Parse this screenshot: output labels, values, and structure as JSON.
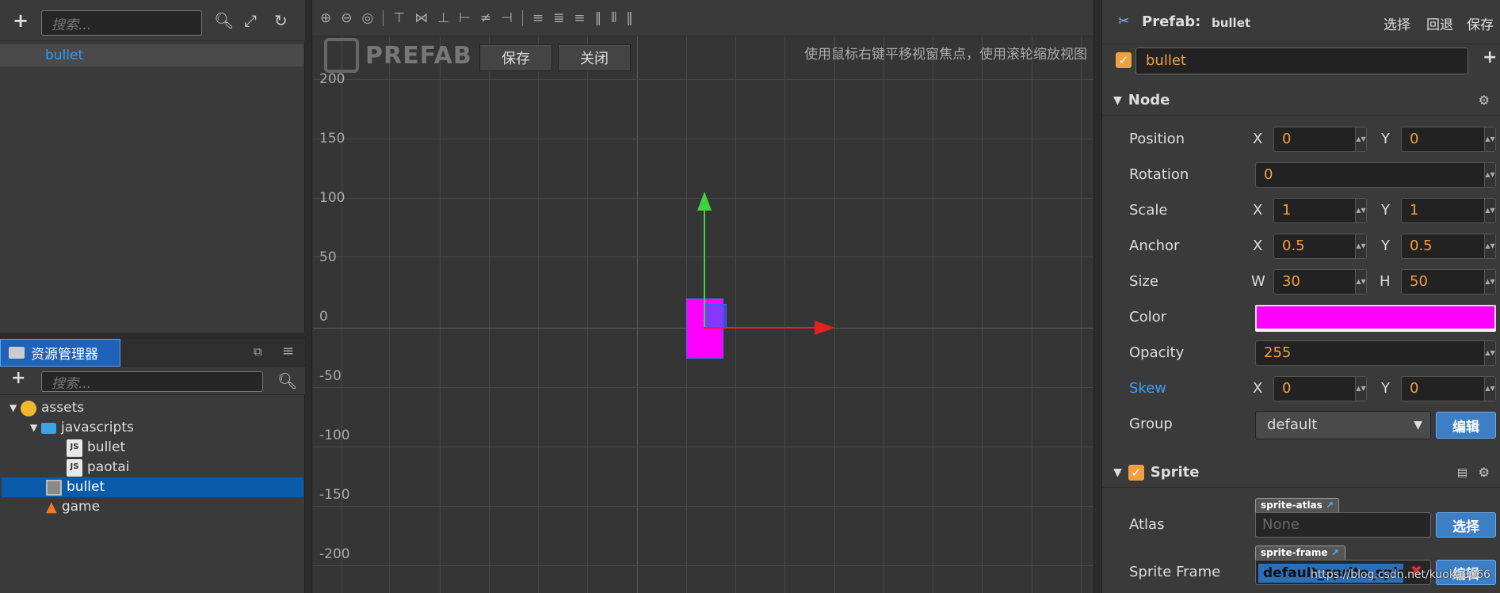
{
  "hierarchy": {
    "search_placeholder": "搜索...",
    "selected_node": "bullet"
  },
  "assets_panel": {
    "tab_label": "资源管理器",
    "search_placeholder": "搜索...",
    "tree": [
      {
        "label": "assets"
      },
      {
        "label": "javascripts"
      },
      {
        "label": "bullet"
      },
      {
        "label": "paotai"
      },
      {
        "label": "bullet"
      },
      {
        "label": "game"
      }
    ]
  },
  "scene": {
    "logo_text": "PREFAB",
    "save_label": "保存",
    "close_label": "关闭",
    "hint": "使用鼠标右键平移视窗焦点，使用滚轮缩放视图",
    "y_labels": [
      "200",
      "150",
      "100",
      "50",
      "0",
      "-50",
      "-100",
      "-150",
      "-200"
    ]
  },
  "inspector": {
    "title": "Prefab:",
    "prefab_name": "bullet",
    "actions": [
      "选择",
      "回退",
      "保存"
    ],
    "node_name": "bullet",
    "node_section": "Node",
    "position_label": "Position",
    "position_x": "0",
    "position_y": "0",
    "rotation_label": "Rotation",
    "rotation": "0",
    "scale_label": "Scale",
    "scale_x": "1",
    "scale_y": "1",
    "anchor_label": "Anchor",
    "anchor_x": "0.5",
    "anchor_y": "0.5",
    "size_label": "Size",
    "size_w": "30",
    "size_h": "50",
    "color_label": "Color",
    "color_value": "#ff00ff",
    "opacity_label": "Opacity",
    "opacity": "255",
    "skew_label": "Skew",
    "skew_x": "0",
    "skew_y": "0",
    "group_label": "Group",
    "group_value": "default",
    "edit_label": "编辑",
    "sprite_section": "Sprite",
    "atlas_label": "Atlas",
    "atlas_tag": "sprite-atlas",
    "atlas_value": "None",
    "select_label": "选择",
    "sprite_frame_label": "Sprite Frame",
    "sprite_frame_tag": "sprite-frame",
    "sprite_frame_value": "default_sprite_spla",
    "axis_x": "X",
    "axis_y": "Y",
    "axis_w": "W",
    "axis_h": "H"
  },
  "watermark": "https://blog.csdn.net/kuoka0066"
}
